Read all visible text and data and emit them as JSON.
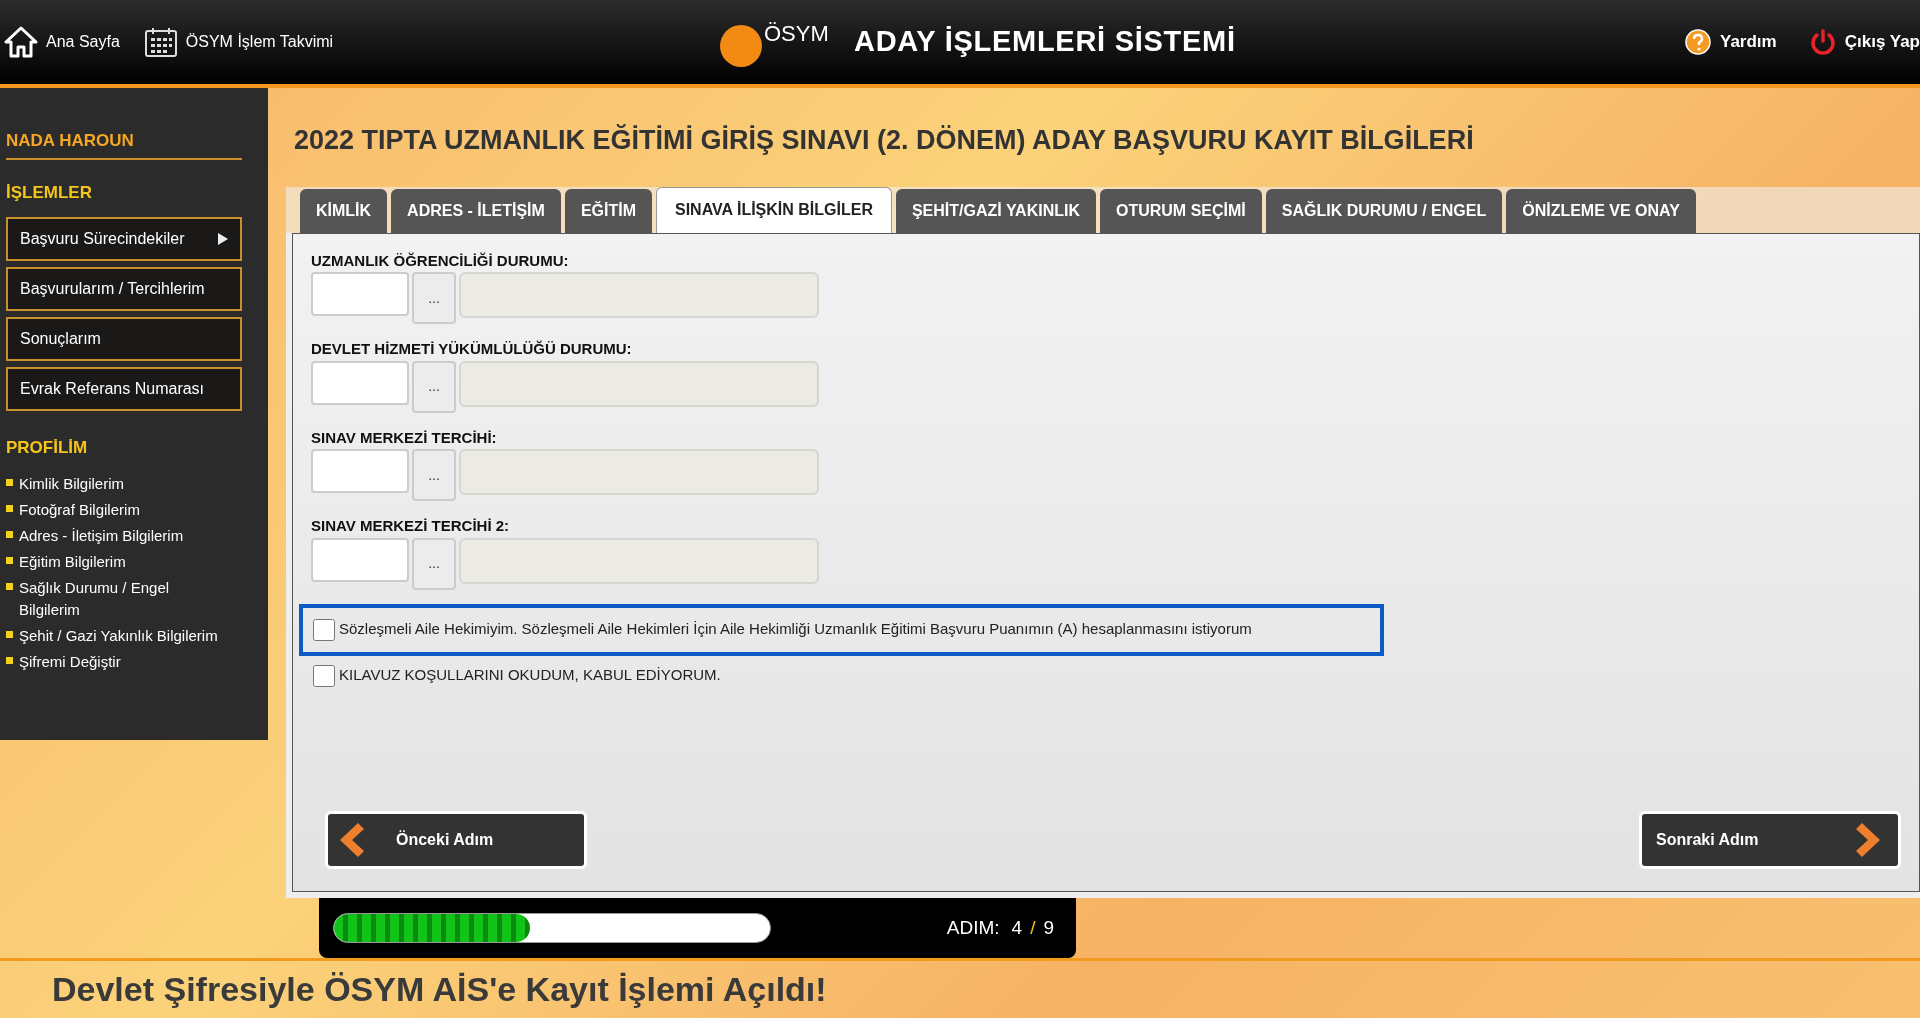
{
  "header": {
    "nav": [
      {
        "kind": "home",
        "label": "Ana Sayfa"
      },
      {
        "kind": "calendar",
        "label": "ÖSYM İşlem Takvimi"
      }
    ],
    "logo_text": "ÖSYM",
    "title": "ADAY İŞLEMLERİ SİSTEMİ",
    "actions": [
      {
        "kind": "help",
        "label": "Yardım"
      },
      {
        "kind": "power",
        "label": "Çıkış Yap"
      }
    ]
  },
  "sidebar": {
    "user": "NADA HAROUN",
    "sections": [
      {
        "title": "İŞLEMLER",
        "kind": "boxes",
        "items": [
          {
            "label": "Başvuru Sürecindekiler",
            "has_arrow": true
          },
          {
            "label": "Başvurularım / Tercihlerim",
            "has_arrow": false
          },
          {
            "label": "Sonuçlarım",
            "has_arrow": false
          },
          {
            "label": "Evrak Referans Numarası",
            "has_arrow": false
          }
        ]
      },
      {
        "title": "PROFİLİM",
        "kind": "bullets",
        "items": [
          {
            "label": "Kimlik Bilgilerim"
          },
          {
            "label": "Fotoğraf Bilgilerim"
          },
          {
            "label": "Adres - İletişim Bilgilerim"
          },
          {
            "label": "Eğitim Bilgilerim"
          },
          {
            "label": "Sağlık Durumu / Engel Bilgilerim"
          },
          {
            "label": "Şehit / Gazi Yakınlık Bilgilerim"
          },
          {
            "label": "Şifremi Değiştir"
          }
        ]
      }
    ]
  },
  "page_title": "2022 TIPTA UZMANLIK EĞİTİMİ GİRİŞ SINAVI (2. DÖNEM) ADAY BAŞVURU KAYIT BİLGİLERİ",
  "tabs": [
    {
      "label": "KİMLİK",
      "selected": false
    },
    {
      "label": "ADRES - İLETİŞİM",
      "selected": false
    },
    {
      "label": "EĞİTİM",
      "selected": false
    },
    {
      "label": "SINAVA İLİŞKİN BİLGİLER",
      "selected": true
    },
    {
      "label": "ŞEHİT/GAZİ YAKINLIK",
      "selected": false
    },
    {
      "label": "OTURUM SEÇİMİ",
      "selected": false
    },
    {
      "label": "SAĞLIK DURUMU / ENGEL",
      "selected": false
    },
    {
      "label": "ÖNİZLEME VE ONAY",
      "selected": false
    }
  ],
  "fields": [
    {
      "label": "UZMANLIK ÖĞRENCİLİĞİ DURUMU:",
      "button": "..."
    },
    {
      "label": "DEVLET HİZMETİ YÜKÜMLÜLÜĞÜ DURUMU:",
      "button": "..."
    },
    {
      "label": "SINAV MERKEZİ TERCİHİ:",
      "button": "..."
    },
    {
      "label": "SINAV MERKEZİ TERCİHİ 2:",
      "button": "..."
    }
  ],
  "checkboxes": [
    {
      "label": "Sözleşmeli Aile Hekimiyim. Sözleşmeli Aile Hekimleri İçin Aile Hekimliği Uzmanlık Eğitimi Başvuru Puanımın (A) hesaplanmasını istiyorum",
      "checked": false,
      "focused": true
    },
    {
      "label": "KILAVUZ KOŞULLARINI OKUDUM, KABUL EDİYORUM.",
      "checked": false,
      "focused": false
    }
  ],
  "buttons": {
    "previous": "Önceki Adım",
    "next": "Sonraki Adım"
  },
  "progress": {
    "level": 0.45,
    "label": "ADIM:",
    "current": "4",
    "separator": "/",
    "total": "9"
  },
  "news_headline": "Devlet Şifresiyle ÖSYM AİS'e Kayıt İşlemi Açıldı!"
}
